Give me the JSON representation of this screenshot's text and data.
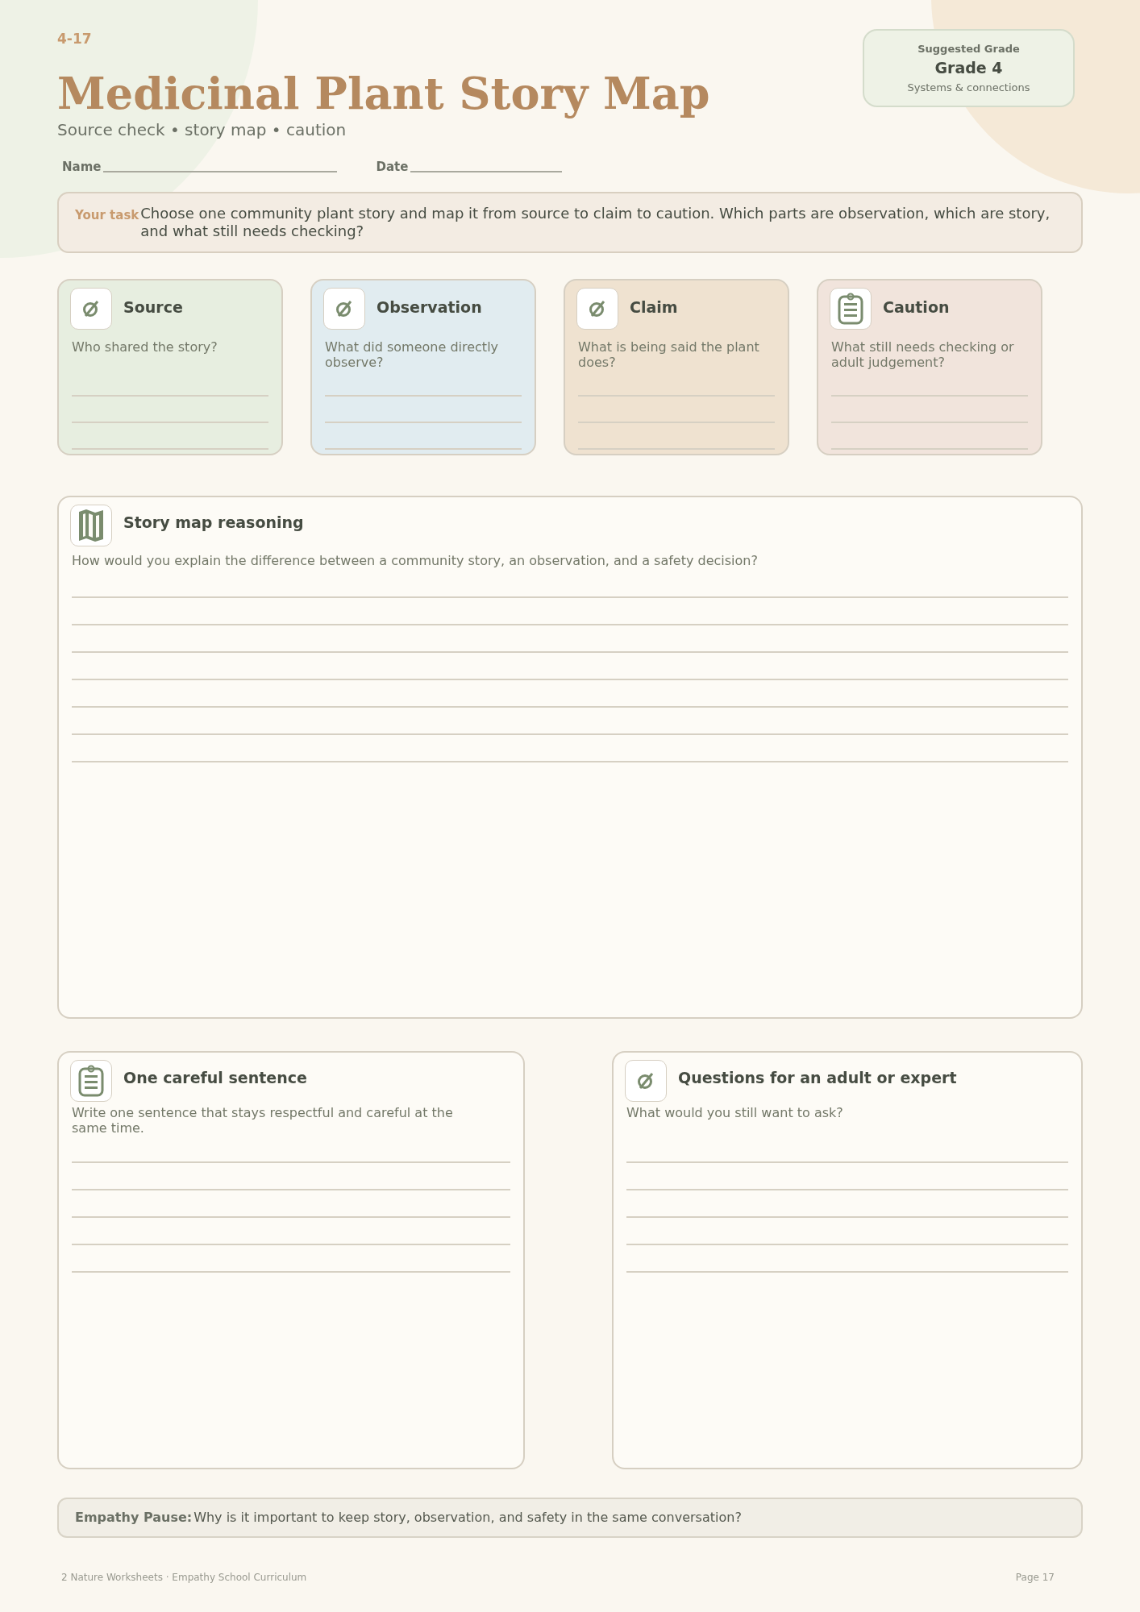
{
  "header": {
    "code": "4-17",
    "title": "Medicinal Plant Story Map",
    "subtitle": "Source check • story map • caution"
  },
  "grade_card": {
    "label": "Suggested Grade",
    "grade": "Grade 4",
    "strand": "Systems & connections"
  },
  "fields": [
    {
      "label": "Name"
    },
    {
      "label": "Date"
    }
  ],
  "task": {
    "label": "Your task",
    "text": "Choose one community plant story and map it from source to claim to caution. Which parts are observation, which are story, and what still needs checking?"
  },
  "cards": [
    {
      "title": "Source",
      "prompt": "Who shared the story?",
      "kind": "slashed",
      "color": "#e7eee0"
    },
    {
      "title": "Observation",
      "prompt": "What did someone directly observe?",
      "kind": "slashed",
      "color": "#e1ecf0"
    },
    {
      "title": "Claim",
      "prompt": "What is being said the plant does?",
      "kind": "slashed",
      "color": "#efe2d0"
    },
    {
      "title": "Caution",
      "prompt": "What still needs checking or adult judgement?",
      "kind": "clipboard",
      "color": "#f1e4dc"
    }
  ],
  "story_map": {
    "title": "Story map reasoning",
    "prompt": "How would you explain the difference between a community story, an observation, and a safety decision?",
    "kind": "map"
  },
  "bottom_panels": [
    {
      "title": "One careful sentence",
      "prompt": "Write one sentence that stays respectful and careful at the same time.",
      "kind": "clipboard"
    },
    {
      "title": "Questions for an adult or expert",
      "prompt": "What would you still want to ask?",
      "kind": "slashed"
    }
  ],
  "empathy_pause": {
    "label": "Empathy Pause:",
    "text": "Why is it important to keep story, observation, and safety in the same conversation?"
  },
  "footer": {
    "left": "2 Nature Worksheets · Empathy School Curriculum",
    "right": "Page 17"
  }
}
